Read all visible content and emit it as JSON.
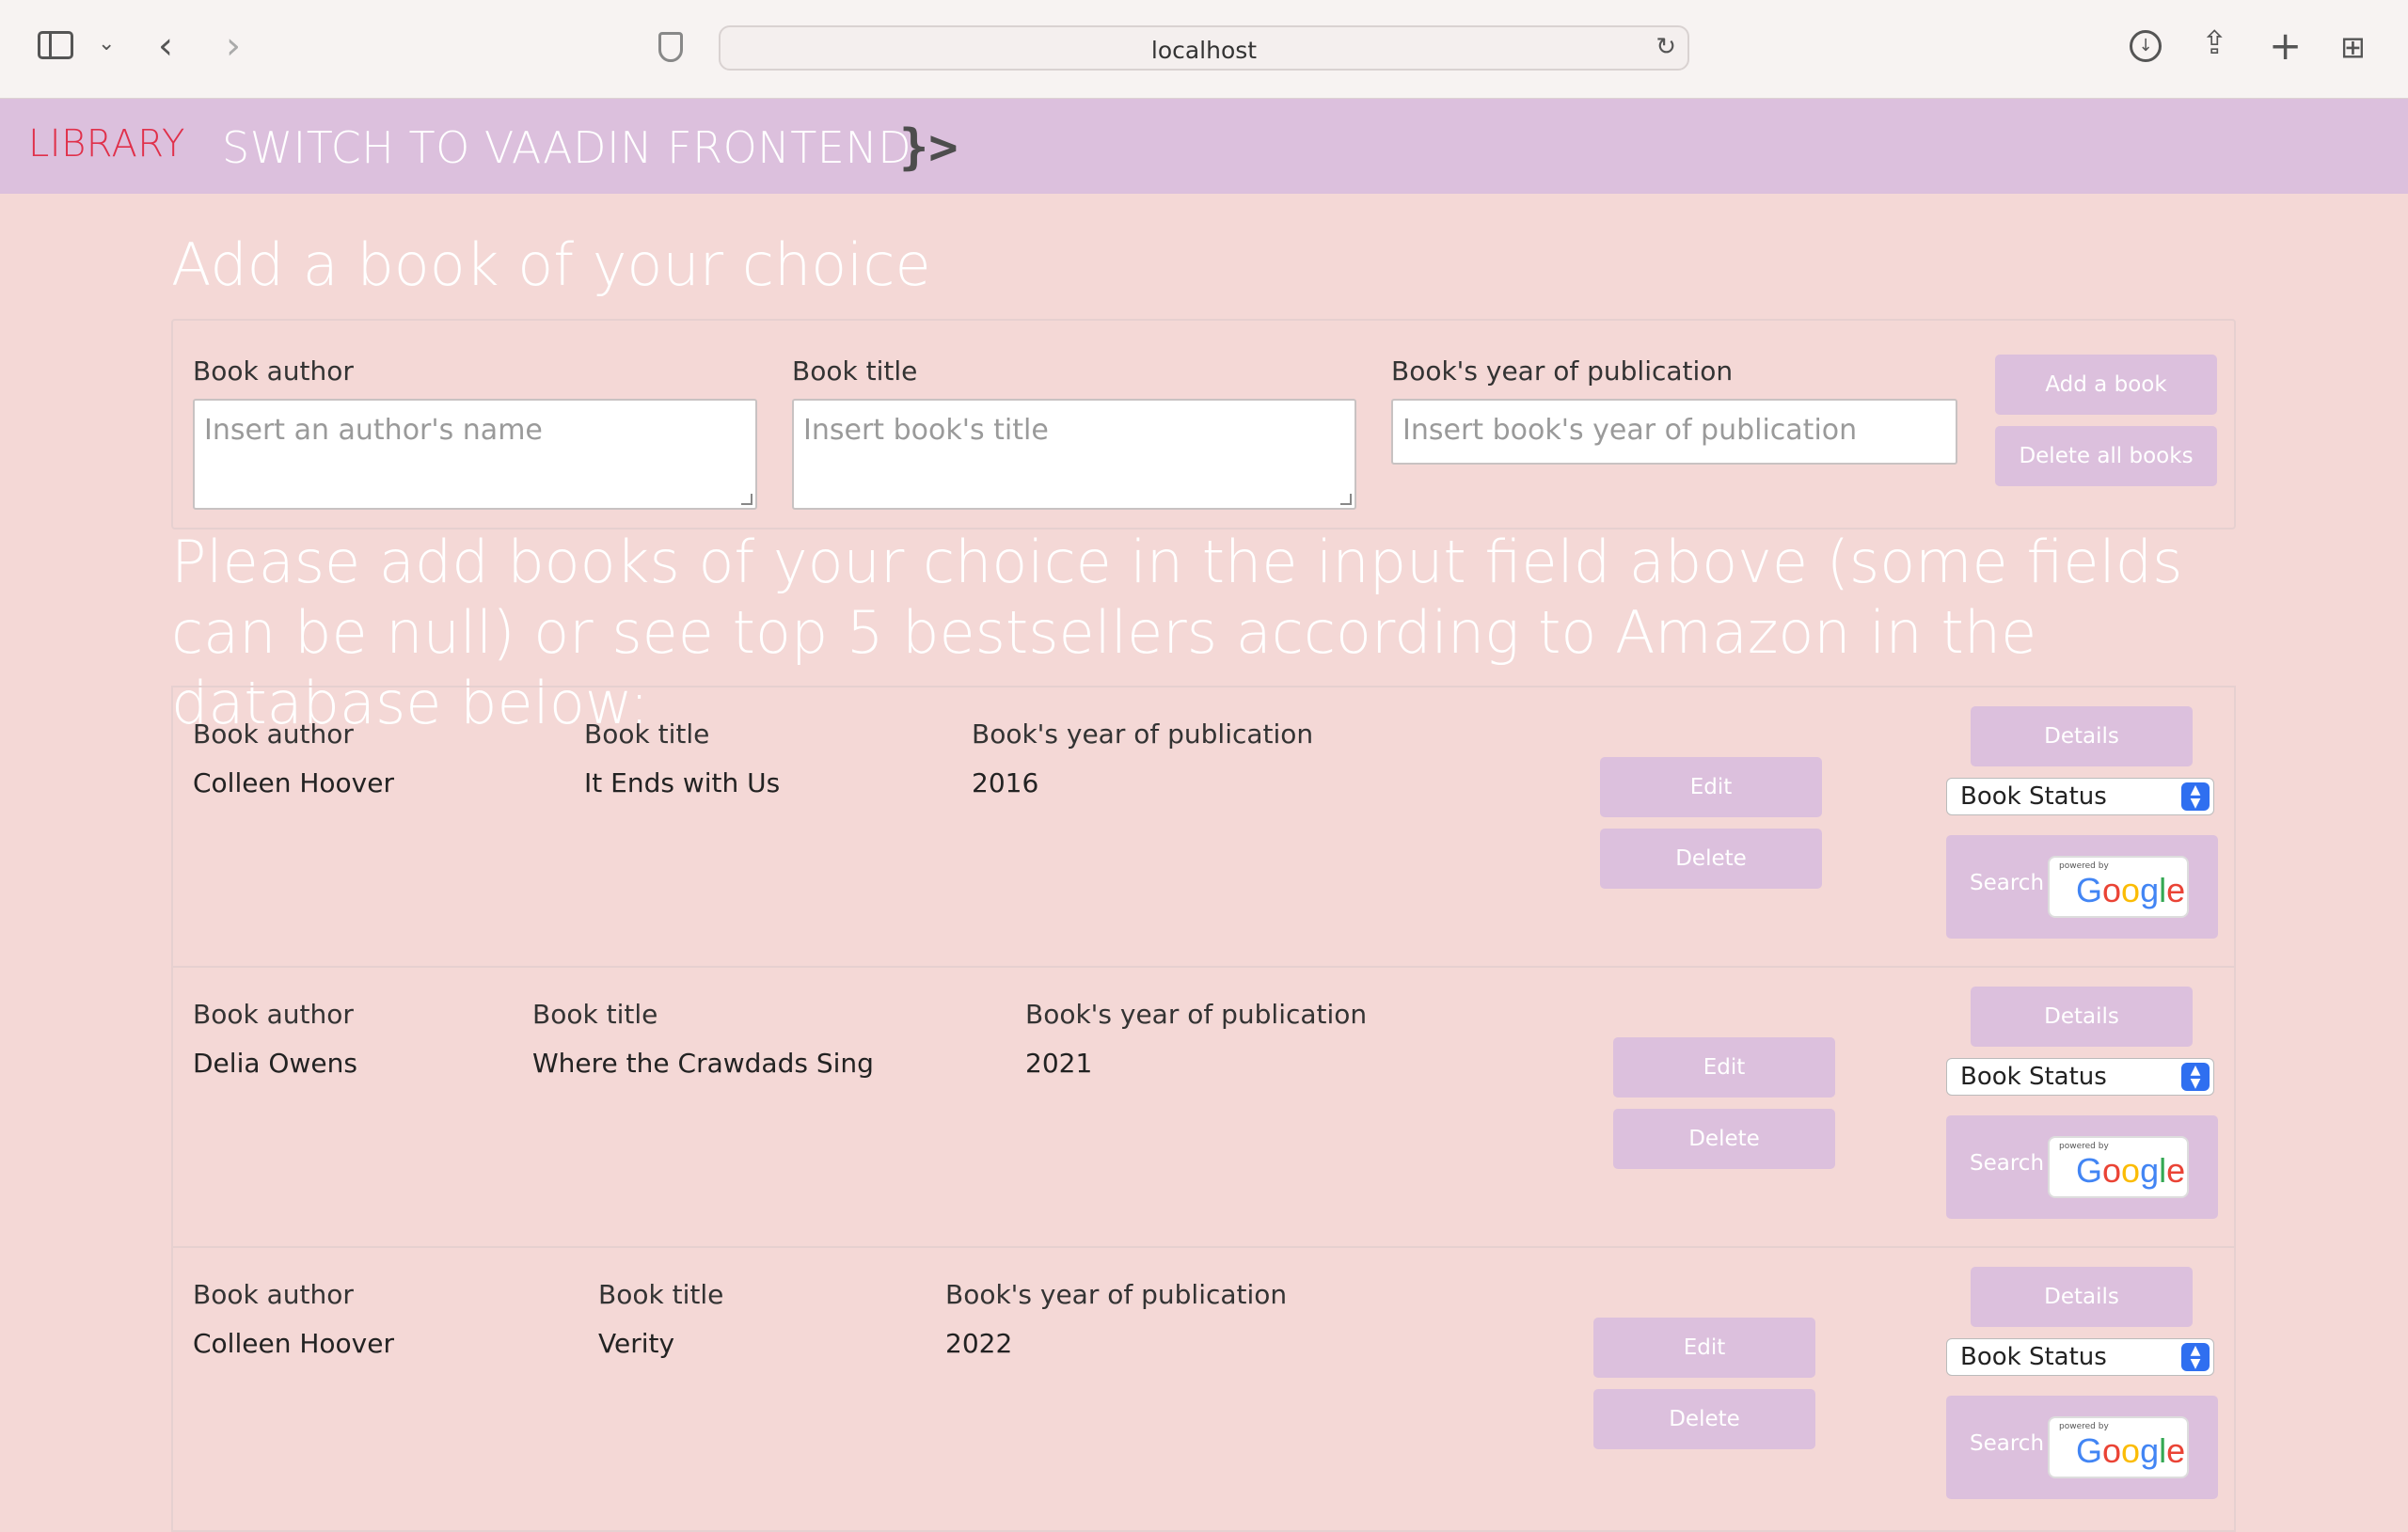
{
  "browser": {
    "url": "localhost"
  },
  "nav": {
    "brand": "LIBRARY",
    "switch_label": "SWITCH TO VAADIN FRONTEND",
    "logo": "}>"
  },
  "add_section": {
    "heading": "Add a book of your choice",
    "author_label": "Book author",
    "author_placeholder": "Insert an author's name",
    "title_label": "Book title",
    "title_placeholder": "Insert book's title",
    "year_label": "Book's year of publication",
    "year_placeholder": "Insert book's year of publication",
    "add_button": "Add a book",
    "delete_all_button": "Delete all books"
  },
  "intro_text": "Please add books of your choice in the input field above (some fields can be null) or see top 5 bestsellers according to Amazon in the database below:",
  "book_headers": {
    "author": "Book author",
    "title": "Book title",
    "year": "Book's year of publication"
  },
  "books": [
    {
      "author": "Colleen Hoover",
      "title": "It Ends with Us",
      "year": "2016"
    },
    {
      "author": "Delia Owens",
      "title": "Where the Crawdads Sing",
      "year": "2021"
    },
    {
      "author": "Colleen Hoover",
      "title": "Verity",
      "year": "2022"
    }
  ],
  "row_actions": {
    "details": "Details",
    "edit": "Edit",
    "delete": "Delete",
    "status_select": "Book Status",
    "search": "Search",
    "powered_by": "powered by",
    "google": "Google"
  },
  "colors": {
    "page_bg": "#f4d8d6",
    "nav_bg": "#dcc0dd",
    "brand": "#e0304a",
    "button_bg": "#dcc0dd"
  }
}
